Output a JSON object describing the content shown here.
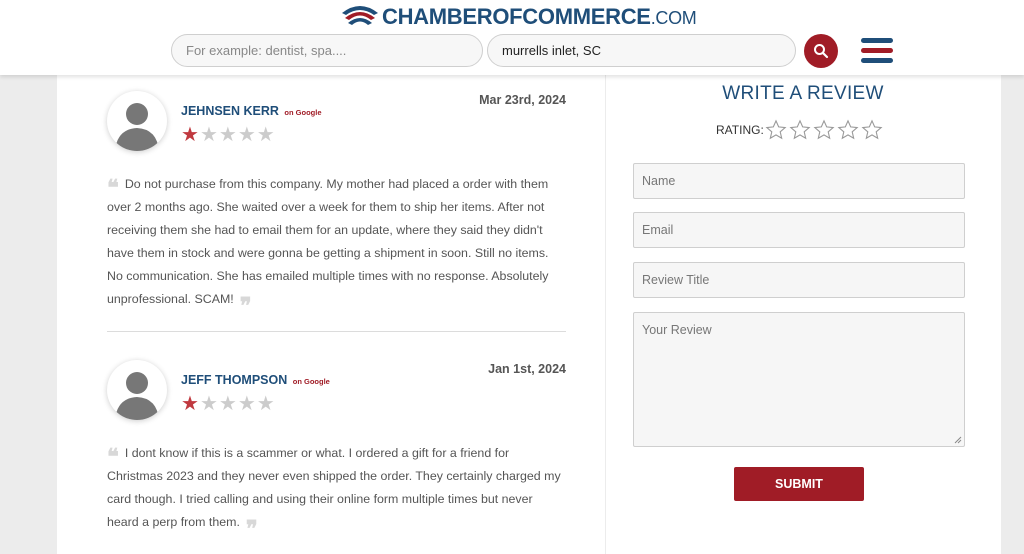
{
  "header": {
    "logo": {
      "part1": "CHAMBER",
      "part2": "OF",
      "part3": "COMMERCE",
      "part4": ".COM"
    },
    "search_what": {
      "placeholder": "For example: dentist, spa...."
    },
    "search_where": {
      "value": "murrells inlet, SC"
    },
    "search_icon": "search-icon",
    "menu_icon": "hamburger-menu-icon",
    "colors": {
      "navy": "#1f4e79",
      "red": "#a01c26"
    }
  },
  "reviews": [
    {
      "name": "JEHNSEN KERR",
      "source": "on Google",
      "date": "Mar 23rd, 2024",
      "rating": 1,
      "max_rating": 5,
      "text": "Do not purchase from this company. My mother had placed a order with them over 2 months ago. She waited over a week for them to ship her items. After not receiving them she had to email them for an update, where they said they didn't have them in stock and were gonna be getting a shipment in soon. Still no items. No communication. She has emailed multiple times with no response. Absolutely unprofessional. SCAM!"
    },
    {
      "name": "JEFF THOMPSON",
      "source": "on Google",
      "date": "Jan 1st, 2024",
      "rating": 1,
      "max_rating": 5,
      "text": "I dont know if this is a scammer or what. I ordered a gift for a friend for Christmas 2023 and they never even shipped the order. They certainly charged my card though. I tried calling and using their online form multiple times but never heard a perp from them."
    }
  ],
  "write_review": {
    "title": "WRITE A REVIEW",
    "rating_label": "RATING:",
    "rating_value": 0,
    "name_placeholder": "Name",
    "email_placeholder": "Email",
    "review_title_placeholder": "Review Title",
    "review_placeholder": "Your Review",
    "submit_label": "SUBMIT"
  }
}
